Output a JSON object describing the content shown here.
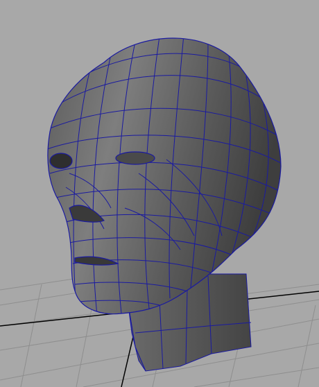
{
  "viewport": {
    "background_color": "#a8a8a8",
    "grid_color": "#8c8c8c",
    "grid_axis_color": "#000000",
    "wireframe_color": "#1a1aa0",
    "mesh_fill_light": "#7a7a7a",
    "mesh_fill_dark": "#3a3a3a",
    "object_type": "polygon-head-mesh"
  }
}
